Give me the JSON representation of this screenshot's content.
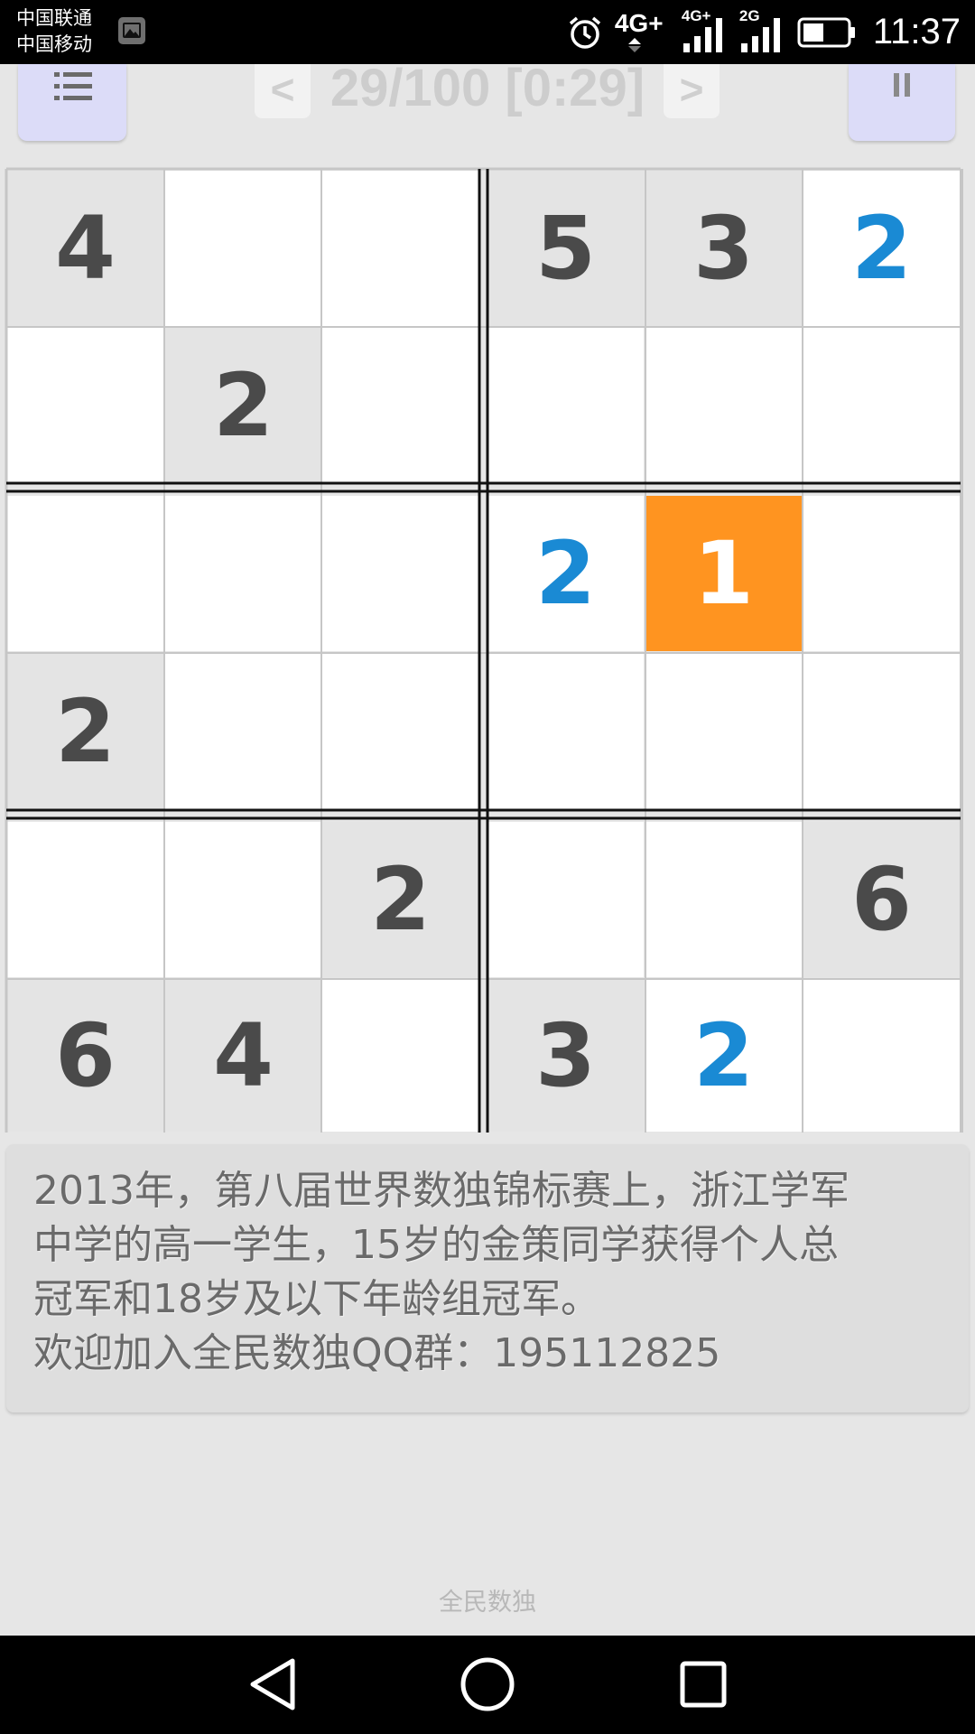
{
  "status_bar": {
    "carrier_1": "中国联通",
    "carrier_2": "中国移动",
    "network_1": "4G+",
    "network_2": "4G+",
    "network_3": "2G",
    "time": "11:37"
  },
  "toolbar": {
    "prev_label": "<",
    "next_label": ">",
    "puzzle_title": "29/100 [0:29]"
  },
  "board": {
    "size": 6,
    "rows": [
      [
        {
          "v": "4",
          "t": "given"
        },
        {
          "v": "",
          "t": "empty"
        },
        {
          "v": "",
          "t": "empty"
        },
        {
          "v": "5",
          "t": "given"
        },
        {
          "v": "3",
          "t": "given"
        },
        {
          "v": "2",
          "t": "entered"
        }
      ],
      [
        {
          "v": "",
          "t": "empty"
        },
        {
          "v": "2",
          "t": "given"
        },
        {
          "v": "",
          "t": "empty"
        },
        {
          "v": "",
          "t": "empty"
        },
        {
          "v": "",
          "t": "empty"
        },
        {
          "v": "",
          "t": "empty"
        }
      ],
      [
        {
          "v": "",
          "t": "empty"
        },
        {
          "v": "",
          "t": "empty"
        },
        {
          "v": "",
          "t": "empty"
        },
        {
          "v": "2",
          "t": "entered"
        },
        {
          "v": "1",
          "t": "selected"
        },
        {
          "v": "",
          "t": "empty"
        }
      ],
      [
        {
          "v": "2",
          "t": "given"
        },
        {
          "v": "",
          "t": "empty"
        },
        {
          "v": "",
          "t": "empty"
        },
        {
          "v": "",
          "t": "empty"
        },
        {
          "v": "",
          "t": "empty"
        },
        {
          "v": "",
          "t": "empty"
        }
      ],
      [
        {
          "v": "",
          "t": "empty"
        },
        {
          "v": "",
          "t": "empty"
        },
        {
          "v": "2",
          "t": "given"
        },
        {
          "v": "",
          "t": "empty"
        },
        {
          "v": "",
          "t": "empty"
        },
        {
          "v": "6",
          "t": "given"
        }
      ],
      [
        {
          "v": "6",
          "t": "given"
        },
        {
          "v": "4",
          "t": "given"
        },
        {
          "v": "",
          "t": "empty"
        },
        {
          "v": "3",
          "t": "given"
        },
        {
          "v": "2",
          "t": "entered"
        },
        {
          "v": "",
          "t": "empty"
        }
      ]
    ],
    "colors": {
      "given_bg": "#e4e4e4",
      "empty_bg": "#ffffff",
      "selected_bg": "#ff9420",
      "given_text": "#4a4a4a",
      "entered_text": "#1a8ad4",
      "thin_line": "#c6c6c6",
      "thick_line": "#111111"
    }
  },
  "tip": {
    "line_1": "2013年，第八届世界数独锦标赛上，浙江学军",
    "line_2": "中学的高一学生，15岁的金策同学获得个人总",
    "line_3": "冠军和18岁及以下年龄组冠军。",
    "line_4": "欢迎加入全民数独QQ群：195112825"
  },
  "app_label": "全民数独",
  "icons": {
    "menu": "list-menu-icon",
    "pause": "pause-icon",
    "alarm": "alarm-clock-icon",
    "gallery": "gallery-notification-icon",
    "battery": "battery-icon",
    "signal": "signal-bars-icon",
    "back": "back-triangle-icon",
    "home": "home-circle-icon",
    "recents": "recents-square-icon"
  }
}
